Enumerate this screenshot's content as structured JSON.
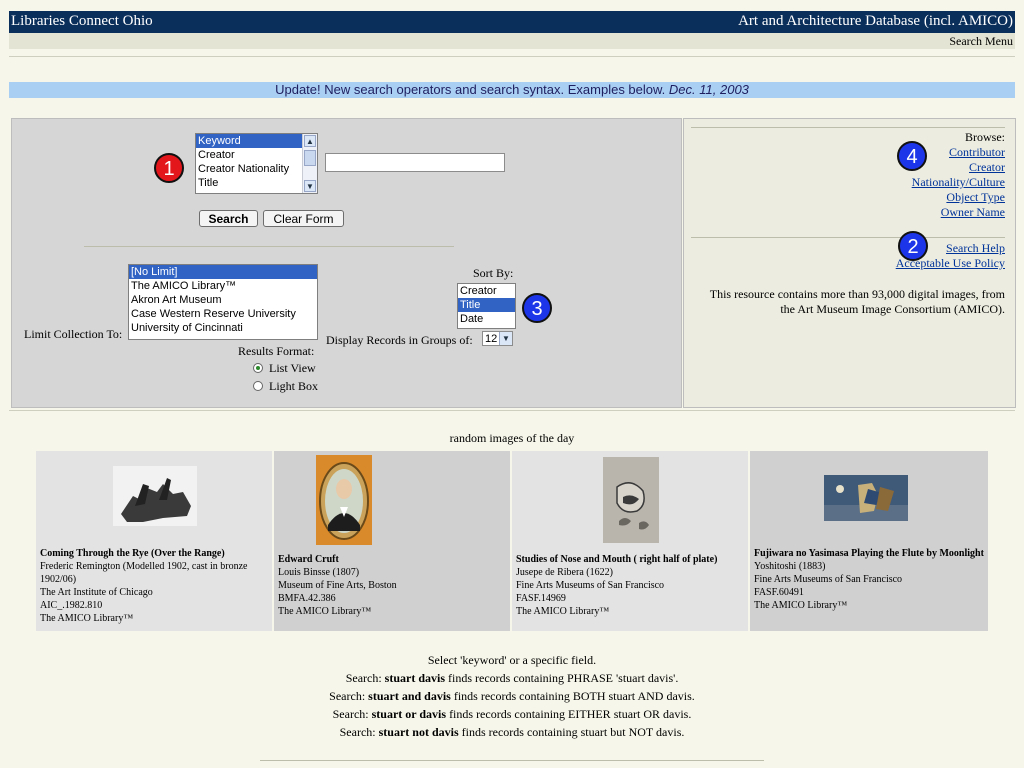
{
  "header": {
    "site_title": "Libraries Connect Ohio",
    "database_title": "Art and Architecture Database (incl. AMICO)",
    "menu_link": "Search Menu"
  },
  "update_banner": {
    "text": "Update! New search operators and search syntax. Examples below.",
    "date": "Dec. 11, 2003"
  },
  "search": {
    "field_options": [
      "Keyword",
      "Creator",
      "Creator Nationality",
      "Title"
    ],
    "field_selected": "Keyword",
    "query_value": "",
    "search_button": "Search",
    "clear_button": "Clear Form",
    "limit_label": "Limit Collection To:",
    "collection_options": [
      "[No Limit]",
      "The AMICO Library™",
      "Akron Art Museum",
      "Case Western Reserve University",
      "University of Cincinnati"
    ],
    "collection_selected": "[No Limit]",
    "sort_label": "Sort By:",
    "sort_options": [
      "Creator",
      "Title",
      "Date"
    ],
    "sort_selected": "Title",
    "display_label": "Display Records in Groups of:",
    "display_value": "12",
    "format_label": "Results Format:",
    "format_options": [
      "List View",
      "Light Box"
    ],
    "format_selected": "List View"
  },
  "badges": {
    "one": "1",
    "two": "2",
    "three": "3",
    "four": "4"
  },
  "browse": {
    "heading": "Browse:",
    "links": [
      "Contributor",
      "Creator",
      "Nationality/Culture",
      "Object Type",
      "Owner Name"
    ],
    "help_link": "Search Help",
    "policy_link": "Acceptable Use Policy",
    "resource_note": "This resource contains more than 93,000 digital images, from the Art Museum Image Consortium (AMICO)."
  },
  "random_images": {
    "heading": "random images of the day",
    "items": [
      {
        "title": "Coming Through the Rye (Over the Range)",
        "creator": "Frederic Remington (Modelled 1902, cast in bronze 1902/06)",
        "owner": "The Art Institute of Chicago",
        "id": "AIC_.1982.810",
        "library": "The AMICO Library™"
      },
      {
        "title": "Edward Cruft",
        "creator": "Louis Binsse (1807)",
        "owner": "Museum of Fine Arts, Boston",
        "id": "BMFA.42.386",
        "library": "The AMICO Library™"
      },
      {
        "title": "Studies of Nose and Mouth ( right half of plate)",
        "creator": "Jusepe de Ribera (1622)",
        "owner": "Fine Arts Museums of San Francisco",
        "id": "FASF.14969",
        "library": "The AMICO Library™"
      },
      {
        "title": "Fujiwara no Yasimasa Playing the Flute by Moonlight",
        "creator": "Yoshitoshi (1883)",
        "owner": "Fine Arts Museums of San Francisco",
        "id": "FASF.60491",
        "library": "The AMICO Library™"
      }
    ]
  },
  "tips": {
    "intro": "Select 'keyword' or a specific field.",
    "lines": [
      {
        "prefix": "Search:",
        "term": "stuart davis",
        "text": "finds records containing PHRASE 'stuart davis'."
      },
      {
        "prefix": "Search:",
        "term": "stuart and davis",
        "text": "finds records containing BOTH stuart AND davis."
      },
      {
        "prefix": "Search:",
        "term": "stuart or davis",
        "text": "finds records containing EITHER stuart OR davis."
      },
      {
        "prefix": "Search:",
        "term": "stuart not davis",
        "text": "finds records containing stuart but NOT davis."
      }
    ]
  },
  "colors": {
    "header_bg": "#0b2f5b",
    "banner_bg": "#a9cff3",
    "selection": "#3163c5",
    "badge_red": "#e3161c",
    "badge_blue": "#1d35e8"
  }
}
